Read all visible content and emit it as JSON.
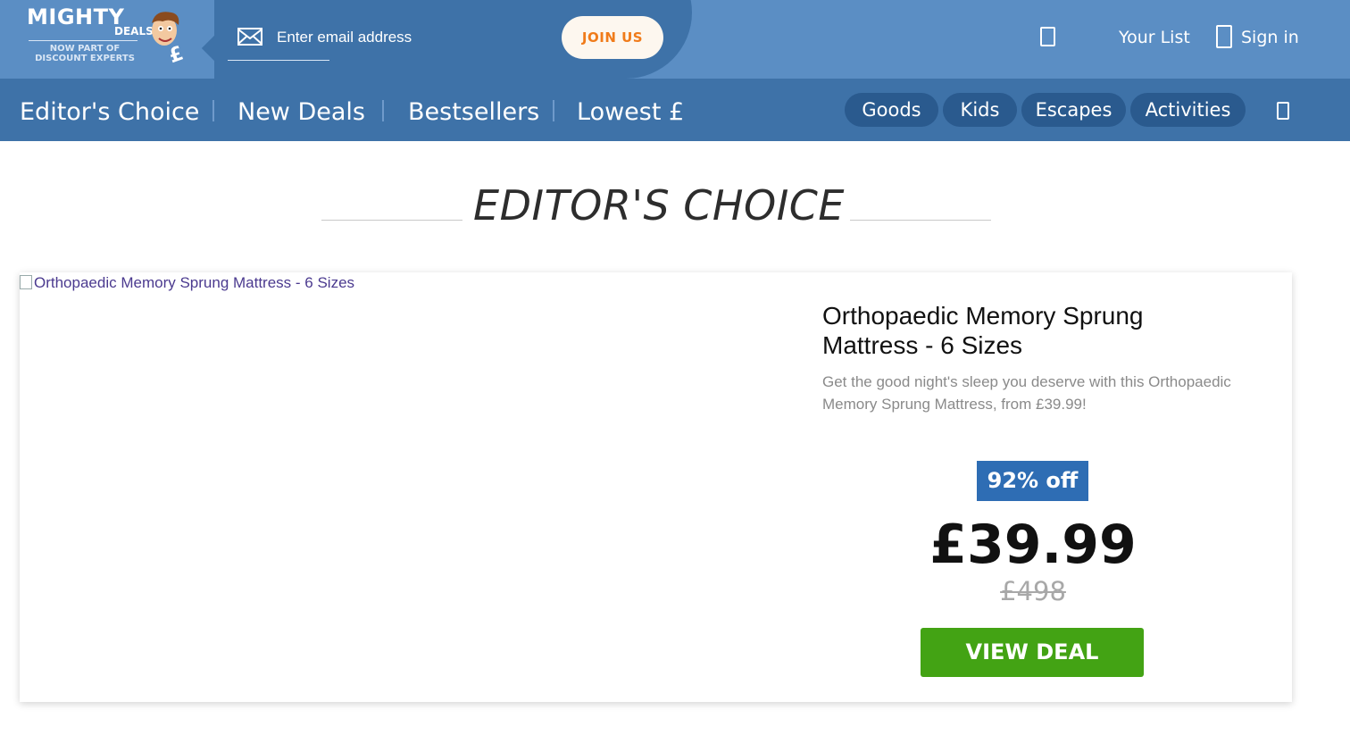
{
  "header": {
    "logo": {
      "line1": "MIGHTY",
      "line2": "DEALS",
      "line3": "NOW PART OF DISCOUNT EXPERTS"
    },
    "signup": {
      "email_placeholder": "Enter email address",
      "join_label": "JOIN US"
    },
    "your_list_label": "Your List",
    "sign_in_label": "Sign in"
  },
  "nav": {
    "items": [
      {
        "label": "Editor's Choice"
      },
      {
        "label": "New Deals"
      },
      {
        "label": "Bestsellers"
      },
      {
        "label": "Lowest £"
      }
    ],
    "categories": [
      {
        "label": "Goods"
      },
      {
        "label": "Kids"
      },
      {
        "label": "Escapes"
      },
      {
        "label": "Activities"
      }
    ]
  },
  "section": {
    "title": "EDITOR'S CHOICE"
  },
  "deal": {
    "image_alt": "Orthopaedic Memory Sprung Mattress - 6 Sizes",
    "title": "Orthopaedic Memory Sprung Mattress - 6 Sizes",
    "description": "Get the good night's sleep you deserve with this Orthopaedic Memory Sprung Mattress, from £39.99!",
    "discount": "92% off",
    "price": "£39.99",
    "old_price": "£498",
    "cta_label": "VIEW DEAL"
  },
  "colors": {
    "topbar": "#5b8ec4",
    "navbar": "#3e72a8",
    "pill": "#2a5a8e",
    "join_text": "#f07b1a",
    "badge": "#2e6db4",
    "cta": "#43a314"
  },
  "icons": [
    "mail-icon",
    "phone-icon",
    "list-icon",
    "signin-icon",
    "more-icon",
    "mascot-icon"
  ]
}
